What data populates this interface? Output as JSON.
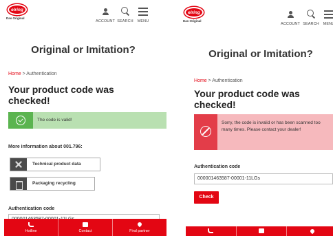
{
  "brand": {
    "logo_text": "elring",
    "tagline": "Das Original"
  },
  "nav": {
    "account": "ACCOUNT",
    "search": "SEARCH",
    "menu": "MENU"
  },
  "page_title": "Original or Imitation?",
  "breadcrumb": {
    "home": "Home",
    "separator": " > ",
    "current": "Authentication"
  },
  "result_heading": "Your product code was checked!",
  "left": {
    "alert_success": "The code is valid!",
    "more_info_heading": "More information about 001.796:",
    "buttons": [
      {
        "label": "Technical product data",
        "icon": "wrench-icon"
      },
      {
        "label": "Packaging recycling",
        "icon": "recycling-icon"
      }
    ],
    "auth_code_label": "Authentication code",
    "auth_code_value": "000001463587-00001-11LGs"
  },
  "right": {
    "alert_error": "Sorry, the code is invalid or has been scanned too many times. Please contact your dealer!",
    "auth_code_label": "Authentication code",
    "auth_code_value": "000001463587-00001-11LGs",
    "check_label": "Check"
  },
  "bottom_bar": [
    {
      "label": "Hotline",
      "icon": "phone-icon"
    },
    {
      "label": "Contact",
      "icon": "chat-icon"
    },
    {
      "label": "Find partner",
      "icon": "location-pin-icon"
    }
  ],
  "colors": {
    "brand_red": "#e30613",
    "success_bg": "#b9e0b1",
    "success_icon": "#5bb450",
    "error_bg": "#f6b9bd",
    "error_icon": "#e33d49"
  }
}
